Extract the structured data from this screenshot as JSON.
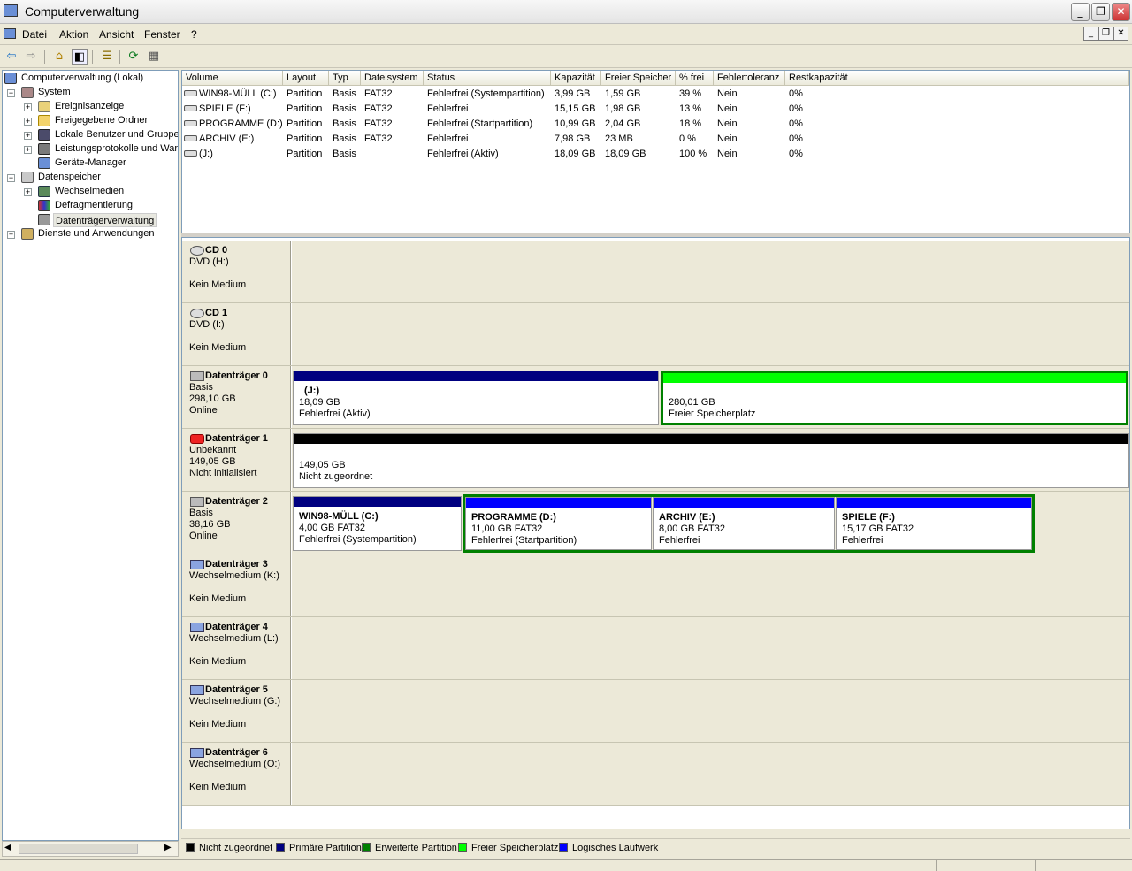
{
  "window": {
    "title": "Computerverwaltung"
  },
  "menu": [
    "Datei",
    "Aktion",
    "Ansicht",
    "Fenster",
    "?"
  ],
  "tree": {
    "root": "Computerverwaltung (Lokal)",
    "system": "System",
    "system_children": [
      "Ereignisanzeige",
      "Freigegebene Ordner",
      "Lokale Benutzer und Gruppen",
      "Leistungsprotokolle und Warnungen",
      "Geräte-Manager"
    ],
    "storage": "Datenspeicher",
    "storage_children": [
      "Wechselmedien",
      "Defragmentierung",
      "Datenträgerverwaltung"
    ],
    "services": "Dienste und Anwendungen"
  },
  "volume_table": {
    "columns": [
      "Volume",
      "Layout",
      "Typ",
      "Dateisystem",
      "Status",
      "Kapazität",
      "Freier Speicher",
      "% frei",
      "Fehlertoleranz",
      "Restkapazität"
    ],
    "rows": [
      [
        "WIN98-MÜLL (C:)",
        "Partition",
        "Basis",
        "FAT32",
        "Fehlerfrei (Systempartition)",
        "3,99 GB",
        "1,59 GB",
        "39 %",
        "Nein",
        "0%"
      ],
      [
        "SPIELE (F:)",
        "Partition",
        "Basis",
        "FAT32",
        "Fehlerfrei",
        "15,15 GB",
        "1,98 GB",
        "13 %",
        "Nein",
        "0%"
      ],
      [
        "PROGRAMME (D:)",
        "Partition",
        "Basis",
        "FAT32",
        "Fehlerfrei (Startpartition)",
        "10,99 GB",
        "2,04 GB",
        "18 %",
        "Nein",
        "0%"
      ],
      [
        "ARCHIV (E:)",
        "Partition",
        "Basis",
        "FAT32",
        "Fehlerfrei",
        "7,98 GB",
        "23 MB",
        "0 %",
        "Nein",
        "0%"
      ],
      [
        "(J:)",
        "Partition",
        "Basis",
        "",
        "Fehlerfrei (Aktiv)",
        "18,09 GB",
        "18,09 GB",
        "100 %",
        "Nein",
        "0%"
      ]
    ]
  },
  "disks": [
    {
      "name": "CD 0",
      "lines": [
        "DVD (H:)",
        "",
        "Kein Medium"
      ]
    },
    {
      "name": "CD 1",
      "lines": [
        "DVD (I:)",
        "",
        "Kein Medium"
      ]
    },
    {
      "name": "Datenträger 0",
      "lines": [
        "Basis",
        "298,10 GB",
        "Online"
      ],
      "partitions": [
        {
          "name": "(J:)",
          "line1": "18,09 GB",
          "line2": "Fehlerfrei (Aktiv)"
        },
        {
          "name": "",
          "line1": "280,01 GB",
          "line2": "Freier Speicherplatz"
        }
      ]
    },
    {
      "name": "Datenträger 1",
      "lines": [
        "Unbekannt",
        "149,05 GB",
        "Nicht initialisiert"
      ],
      "partitions": [
        {
          "name": "",
          "line1": "149,05 GB",
          "line2": "Nicht zugeordnet"
        }
      ]
    },
    {
      "name": "Datenträger 2",
      "lines": [
        "Basis",
        "38,16 GB",
        "Online"
      ],
      "partitions": [
        {
          "name": "WIN98-MÜLL  (C:)",
          "line1": "4,00 GB FAT32",
          "line2": "Fehlerfrei (Systempartition)"
        },
        {
          "name": "PROGRAMME  (D:)",
          "line1": "11,00 GB FAT32",
          "line2": "Fehlerfrei (Startpartition)"
        },
        {
          "name": "ARCHIV  (E:)",
          "line1": "8,00 GB FAT32",
          "line2": "Fehlerfrei"
        },
        {
          "name": "SPIELE  (F:)",
          "line1": "15,17 GB FAT32",
          "line2": "Fehlerfrei"
        }
      ]
    },
    {
      "name": "Datenträger 3",
      "lines": [
        "Wechselmedium (K:)",
        "",
        "Kein Medium"
      ]
    },
    {
      "name": "Datenträger 4",
      "lines": [
        "Wechselmedium (L:)",
        "",
        "Kein Medium"
      ]
    },
    {
      "name": "Datenträger 5",
      "lines": [
        "Wechselmedium (G:)",
        "",
        "Kein Medium"
      ]
    },
    {
      "name": "Datenträger 6",
      "lines": [
        "Wechselmedium (O:)",
        "",
        "Kein Medium"
      ]
    }
  ],
  "legend": [
    {
      "label": "Nicht zugeordnet",
      "color": "#000000"
    },
    {
      "label": "Primäre Partition",
      "color": "#000080"
    },
    {
      "label": "Erweiterte Partition",
      "color": "#008000"
    },
    {
      "label": "Freier Speicherplatz",
      "color": "#00ff00"
    },
    {
      "label": "Logisches Laufwerk",
      "color": "#0000ff"
    }
  ],
  "colors": {
    "primary": "#000080",
    "free": "#00ff00",
    "extended": "#008000",
    "unallocated": "#000000",
    "logical": "#0000ff",
    "selection": "#e8e8e0"
  }
}
